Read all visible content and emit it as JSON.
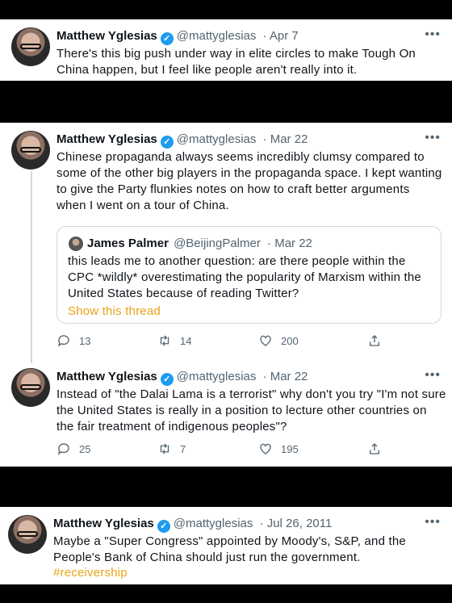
{
  "tweets": [
    {
      "name": "Matthew Yglesias",
      "handle": "@mattyglesias",
      "date": "· Apr 7",
      "text": "There's this big push under way in elite circles to make Tough On China happen, but I feel like people aren't really into it."
    },
    {
      "name": "Matthew Yglesias",
      "handle": "@mattyglesias",
      "date": "· Mar 22",
      "text": "Chinese propaganda always seems incredibly clumsy compared to some of the other big players in the propaganda space. I kept wanting to give the Party flunkies notes on how to craft better arguments when I went on a tour of China.",
      "quote": {
        "name": "James Palmer",
        "handle": "@BeijingPalmer",
        "date": "· Mar 22",
        "text": "this leads me to another question: are there people within the CPC *wildly* overestimating the popularity of Marxism within the United States because of reading Twitter?",
        "show_thread": "Show this thread"
      },
      "replies": "13",
      "retweets": "14",
      "likes": "200"
    },
    {
      "name": "Matthew Yglesias",
      "handle": "@mattyglesias",
      "date": "· Mar 22",
      "text": "Instead of \"the Dalai Lama is a terrorist\" why don't you try \"I'm not sure the United States is really in a position to lecture other countries on the fair treatment of indigenous peoples\"?",
      "replies": "25",
      "retweets": "7",
      "likes": "195"
    },
    {
      "name": "Matthew Yglesias",
      "handle": "@mattyglesias",
      "date": "· Jul 26, 2011",
      "text": "Maybe a \"Super Congress\" appointed by Moody's, S&P, and the People's Bank of China should just run the government.",
      "hashtag": "#receivership"
    }
  ],
  "colors": {
    "verified": "#1d9bf0",
    "secondary": "#536471",
    "link": "#e8a317"
  },
  "icons": {
    "reply": "reply-icon",
    "retweet": "retweet-icon",
    "like": "heart-icon",
    "share": "share-icon",
    "more": "more-icon",
    "verified": "verified-badge-icon"
  }
}
